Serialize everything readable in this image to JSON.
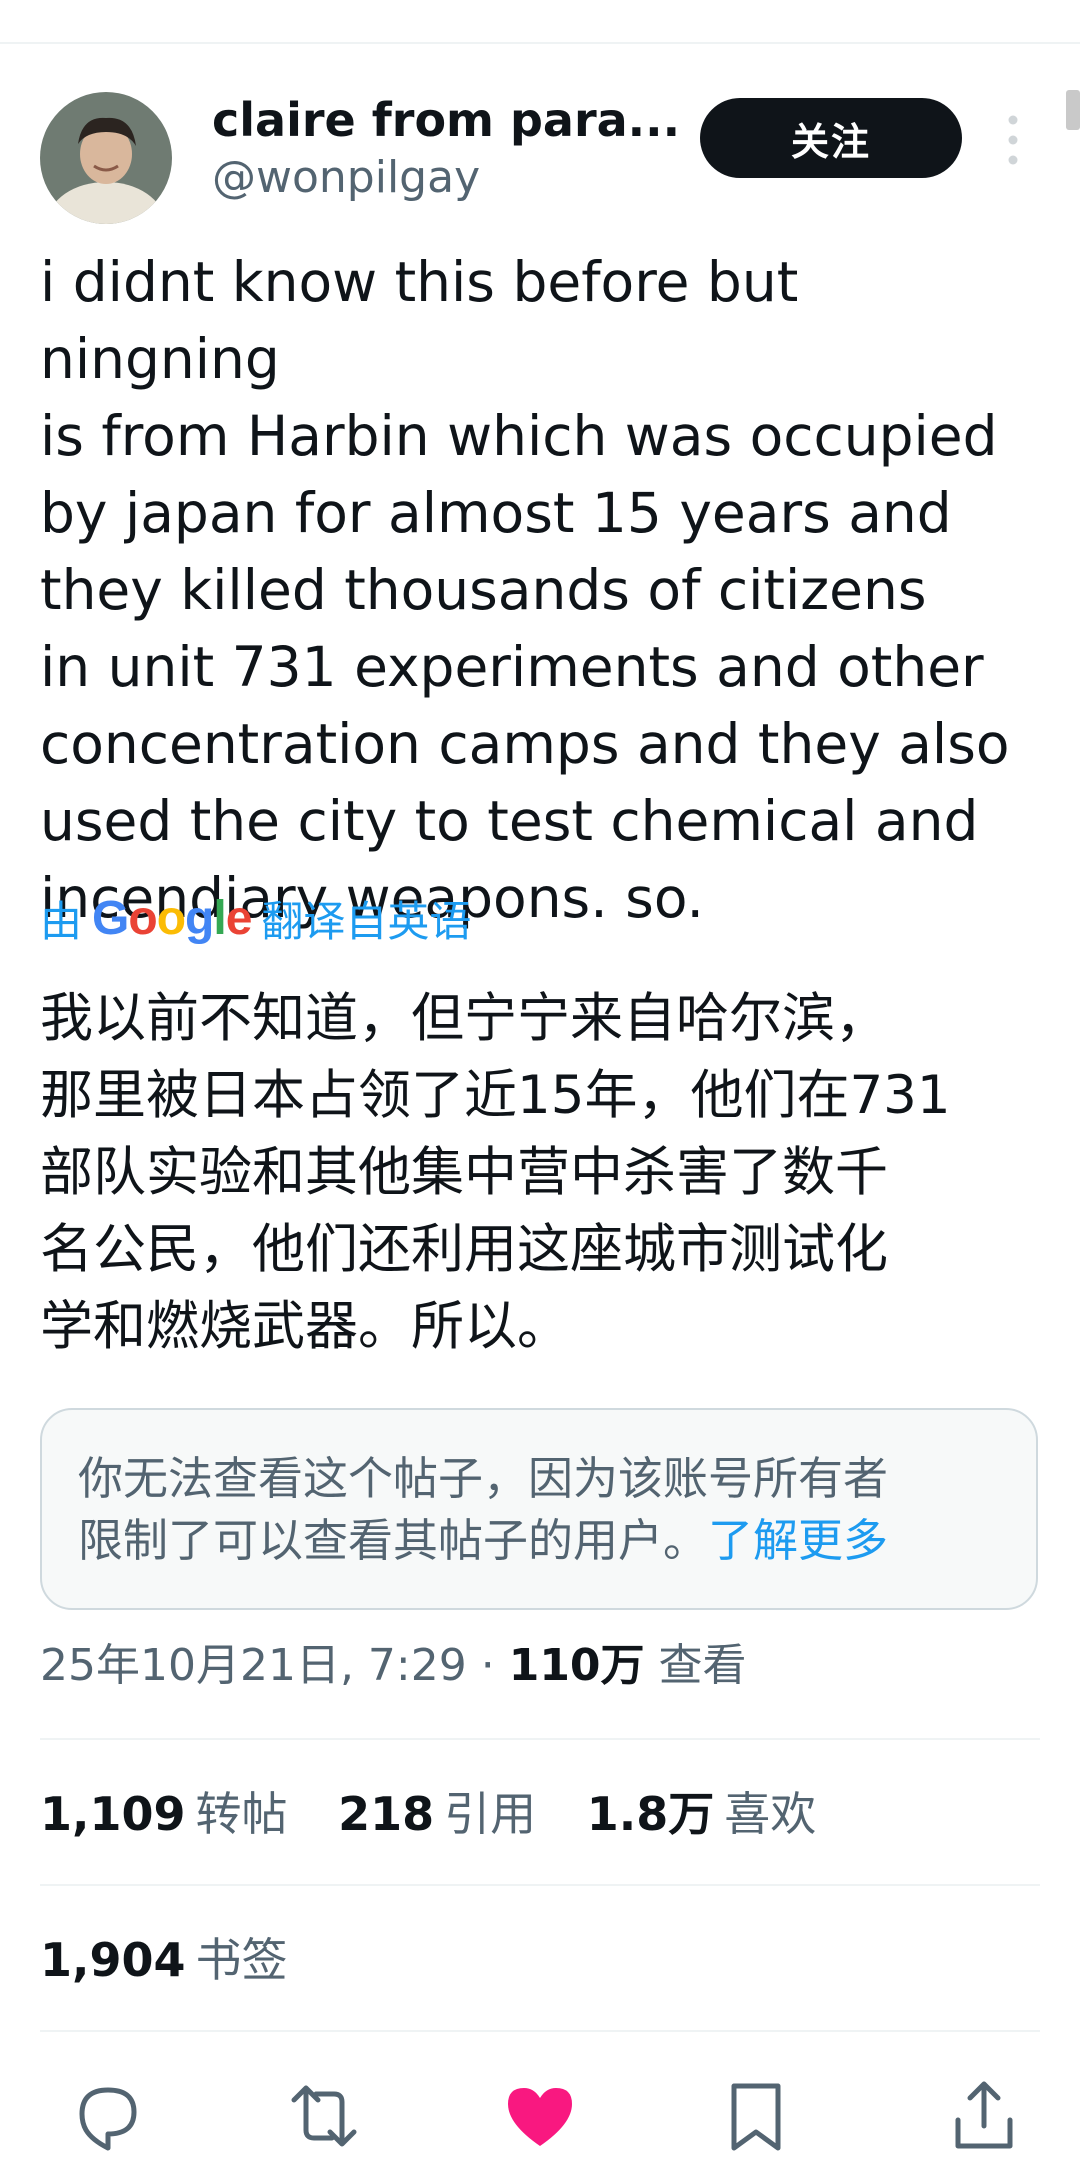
{
  "author": {
    "display_name": "claire from para...",
    "handle": "@wonpilgay"
  },
  "follow_button_label": "关注",
  "tweet": {
    "text_lines": [
      "i didnt know this before but ningning",
      "is from Harbin which was occupied",
      "by japan for almost 15 years and",
      "they killed thousands of citizens",
      "in unit 731 experiments and other",
      "concentration camps and they also",
      "used the city to test chemical and",
      "incendiary weapons. so."
    ],
    "translation_prefix": "由",
    "translation_provider": "Google",
    "translation_suffix": "翻译自英语",
    "translated_lines": [
      "我以前不知道，但宁宁来自哈尔滨，",
      "那里被日本占领了近15年，他们在731",
      "部队实验和其他集中营中杀害了数千",
      "名公民，他们还利用这座城市测试化",
      "学和燃烧武器。所以。"
    ]
  },
  "notice": {
    "line1": "你无法查看这个帖子，因为该账号所有者",
    "line2_text": "限制了可以查看其帖子的用户。",
    "link_label": "了解更多"
  },
  "meta": {
    "timestamp": "25年10月21日, 7:29 · ",
    "views_count": "110万",
    "views_label": " 查看"
  },
  "stats": {
    "reposts": {
      "count": "1,109",
      "label": "转帖"
    },
    "quotes": {
      "count": "218",
      "label": "引用"
    },
    "likes": {
      "count": "1.8万",
      "label": "喜欢"
    },
    "bookmarks": {
      "count": "1,904",
      "label": "书签"
    }
  },
  "actions": [
    "reply-icon",
    "repost-icon",
    "like-icon",
    "bookmark-icon",
    "share-icon"
  ],
  "colors": {
    "link_blue": "#1d9bf0",
    "text_primary": "#0f1419",
    "text_secondary": "#536471",
    "like_pink": "#f91880"
  }
}
